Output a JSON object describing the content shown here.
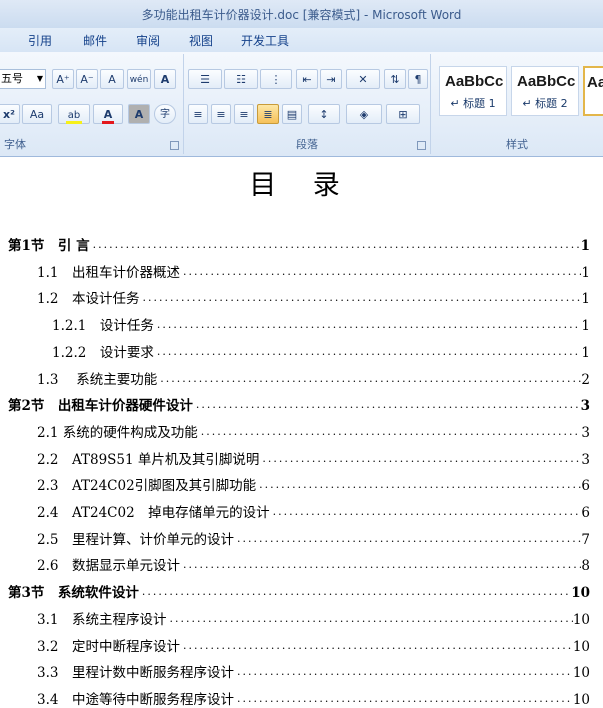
{
  "window": {
    "title": "多功能出租车计价器设计.doc [兼容模式] - Microsoft Word"
  },
  "menu": {
    "tabs": [
      "引用",
      "邮件",
      "审阅",
      "视图",
      "开发工具"
    ]
  },
  "ribbon": {
    "font_group": {
      "label": "字体",
      "font_size": "五号",
      "grow_font": "A⁺",
      "shrink_font": "A⁻",
      "clear_format": "A",
      "phonetic": "wén",
      "char_border": "A",
      "superscript": "x²",
      "change_case": "Aa",
      "highlight": "ab",
      "font_color": "A",
      "char_shading": "A",
      "enclose_char": "字"
    },
    "paragraph_group": {
      "label": "段落"
    },
    "styles_group": {
      "label": "样式",
      "styles": [
        {
          "sample": "AaBbCc",
          "name": "↵ 标题 1"
        },
        {
          "sample": "AaBbCc",
          "name": "↵ 标题 2"
        },
        {
          "sample": "Aa",
          "name": ""
        }
      ]
    }
  },
  "document": {
    "toc_title": "目 录",
    "entries": [
      {
        "level": 1,
        "label": "第1节　引 言",
        "page": "1"
      },
      {
        "level": 2,
        "label": "1.1　出租车计价器概述",
        "page": "1"
      },
      {
        "level": 2,
        "label": "1.2　本设计任务",
        "page": "1"
      },
      {
        "level": 3,
        "label": "1.2.1　设计任务",
        "page": "1"
      },
      {
        "level": 3,
        "label": "1.2.2　设计要求",
        "page": "1"
      },
      {
        "level": 2,
        "label": "1.3　 系统主要功能",
        "page": "2"
      },
      {
        "level": 1,
        "label": "第2节　出租车计价器硬件设计",
        "page": "3"
      },
      {
        "level": 2,
        "label": "2.1 系统的硬件构成及功能",
        "page": "3"
      },
      {
        "level": 2,
        "label": "2.2　AT89S51 单片机及其引脚说明",
        "page": "3"
      },
      {
        "level": 2,
        "label": "2.3　AT24C02引脚图及其引脚功能",
        "page": "6"
      },
      {
        "level": 2,
        "label": "2.4　AT24C02　掉电存储单元的设计",
        "page": "6"
      },
      {
        "level": 2,
        "label": "2.5　里程计算、计价单元的设计",
        "page": "7"
      },
      {
        "level": 2,
        "label": "2.6　数据显示单元设计",
        "page": "8"
      },
      {
        "level": 1,
        "label": "第3节　系统软件设计",
        "page": "10"
      },
      {
        "level": 2,
        "label": "3.1　系统主程序设计",
        "page": "10"
      },
      {
        "level": 2,
        "label": "3.2　定时中断程序设计",
        "page": "10"
      },
      {
        "level": 2,
        "label": "3.3　里程计数中断服务程序设计",
        "page": "10"
      },
      {
        "level": 2,
        "label": "3.4　中途等待中断服务程序设计",
        "page": "10"
      }
    ]
  }
}
